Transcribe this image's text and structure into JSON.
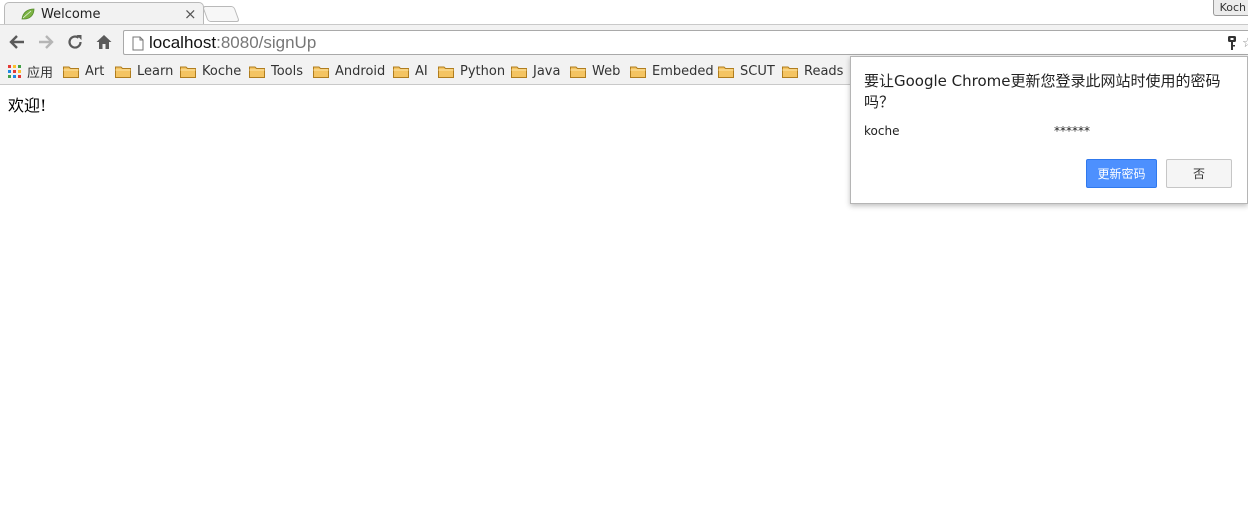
{
  "tab": {
    "title": "Welcome",
    "favicon": "leaf-icon",
    "close_glyph": "×"
  },
  "profile": {
    "name": "Koch"
  },
  "toolbar": {
    "back_icon": "arrow-left-icon",
    "forward_icon": "arrow-right-icon",
    "reload_icon": "reload-icon",
    "home_icon": "home-icon"
  },
  "omnibox": {
    "host": "localhost",
    "rest": ":8080/signUp"
  },
  "bookmarks": {
    "apps_label": "应用",
    "items": [
      "Art",
      "Learn",
      "Koche",
      "Tools",
      "Android",
      "AI",
      "Python",
      "Java",
      "Web",
      "Embeded",
      "SCUT",
      "Reads"
    ]
  },
  "page": {
    "text": "欢迎!"
  },
  "password_bubble": {
    "title": "要让Google Chrome更新您登录此网站时使用的密码吗？",
    "username": "koche",
    "password": "******",
    "update_label": "更新密码",
    "no_label": "否"
  },
  "colors": {
    "accent_button": "#4d90fe",
    "folder": "#f4c462"
  }
}
